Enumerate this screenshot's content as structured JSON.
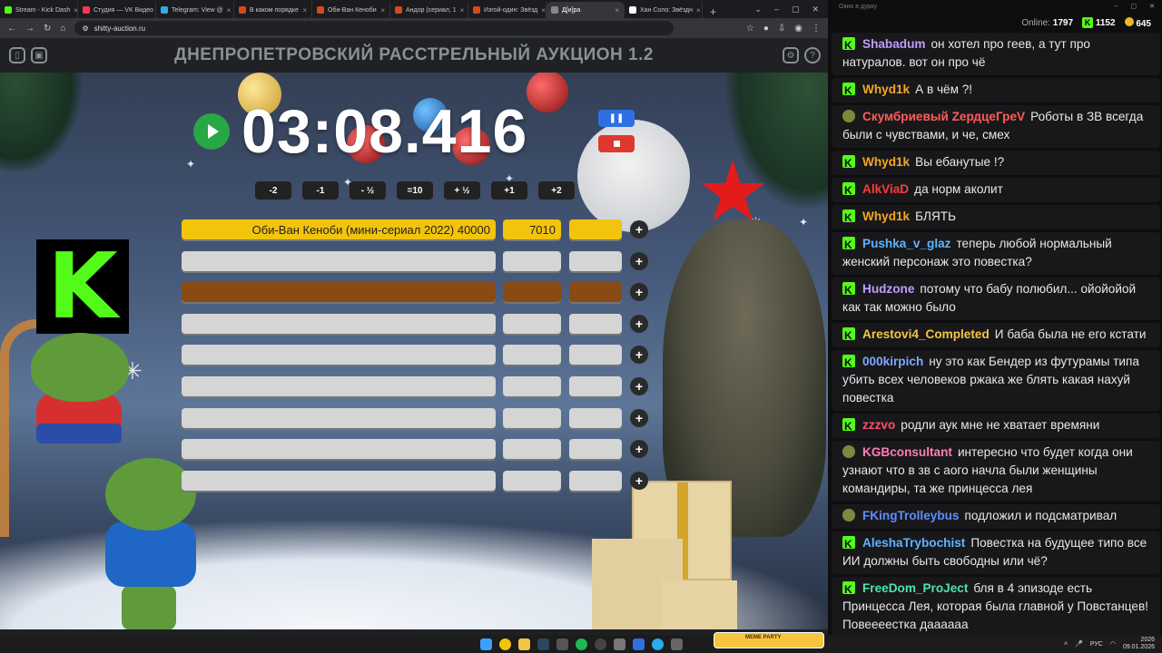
{
  "browser": {
    "tabs": [
      {
        "label": "Stream - Kick Dash",
        "color": "#53fc18",
        "active": false
      },
      {
        "label": "Студия — VK Видео",
        "color": "#ff3355",
        "active": false
      },
      {
        "label": "Telegram: View @",
        "color": "#2aabee",
        "active": false
      },
      {
        "label": "В каком порядке",
        "color": "#d44a1f",
        "active": false
      },
      {
        "label": "Оби-Ван Кеноби",
        "color": "#d44a1f",
        "active": false
      },
      {
        "label": "Андор (сериал, 1",
        "color": "#d44a1f",
        "active": false
      },
      {
        "label": "Изгой-один: Звёзд",
        "color": "#d44a1f",
        "active": false
      },
      {
        "label": "Д[и]ра",
        "color": "#888888",
        "active": true
      },
      {
        "label": "Хан Соло: Звёздн",
        "color": "#ffffff",
        "active": false
      }
    ],
    "url": "shitty-auction.ru"
  },
  "auction": {
    "title": "ДНЕПРОПЕТРОВСКИЙ РАССТРЕЛЬНЫЙ АУКЦИОН 1.2",
    "timer": "03:08.416",
    "adjust_buttons": [
      "-2",
      "-1",
      "- ½",
      "=10",
      "+ ½",
      "+1",
      "+2"
    ],
    "lots": [
      {
        "name": "Оби-Ван Кеноби (мини-сериал 2022) 40000",
        "amount": "7010",
        "style": "gold"
      },
      {
        "name": "",
        "amount": "",
        "style": "empty"
      },
      {
        "name": "",
        "amount": "",
        "style": "brown"
      },
      {
        "name": "",
        "amount": "",
        "style": "empty"
      },
      {
        "name": "",
        "amount": "",
        "style": "empty"
      },
      {
        "name": "",
        "amount": "",
        "style": "empty"
      },
      {
        "name": "",
        "amount": "",
        "style": "empty"
      },
      {
        "name": "",
        "amount": "",
        "style": "empty"
      },
      {
        "name": "",
        "amount": "",
        "style": "empty"
      }
    ]
  },
  "chat": {
    "window_title": "Окно в дурку",
    "online_label": "Online:",
    "online_count": "1797",
    "followers": "1152",
    "coins": "645",
    "messages": [
      {
        "user": "Shabadum",
        "color": "#c39bff",
        "badge": "kick",
        "text": "он хотел про геев, а тут про натуралов. вот он про чё"
      },
      {
        "user": "Whyd1k",
        "color": "#f5a623",
        "badge": "kick",
        "text": "А в чём ?!"
      },
      {
        "user": "Скумбриевый ZердцеГреV",
        "color": "#ff5c5c",
        "badge": "mod",
        "text": "Роботы в ЗВ всегда были с чувствами, и че, смех"
      },
      {
        "user": "Whyd1k",
        "color": "#f5a623",
        "badge": "kick",
        "text": "Вы ебанутые !?"
      },
      {
        "user": "AlkViaD",
        "color": "#ff3b3b",
        "badge": "kick",
        "text": "да норм аколит"
      },
      {
        "user": "Whyd1k",
        "color": "#f5a623",
        "badge": "kick",
        "text": "БЛЯТЬ"
      },
      {
        "user": "Pushka_v_glaz",
        "color": "#5fb3ff",
        "badge": "kick",
        "text": "теперь любой нормальный женский персонаж это повестка?"
      },
      {
        "user": "Hudzone",
        "color": "#c39bff",
        "badge": "kick",
        "text": "потому что бабу полюбил... ойойойой как так можно было"
      },
      {
        "user": "Arestovi4_Completed",
        "color": "#f5c542",
        "badge": "kick",
        "text": "И баба была не его кстати"
      },
      {
        "user": "000kirpich",
        "color": "#7fa8ff",
        "badge": "kick",
        "text": "ну это как Бендер из футурамы типа убить всех человеков ржака же блять какая нахуй повестка"
      },
      {
        "user": "zzzvo",
        "color": "#ff4d6d",
        "badge": "kick",
        "text": "родли аук мне не хватает времяни"
      },
      {
        "user": "KGBconsultant",
        "color": "#ff7eb6",
        "badge": "mod",
        "text": "интересно что будет когда они узнают что в зв с аого начла были женщины командиры, та же принцесса лея"
      },
      {
        "user": "FKingTrolleybus",
        "color": "#5f8dff",
        "badge": "mod",
        "text": "подложил и подсматривал"
      },
      {
        "user": "AleshaTrybochist",
        "color": "#5fb3ff",
        "badge": "kick",
        "text": "Повестка на будущее типо все ИИ должны быть свободны или чё?"
      },
      {
        "user": "FreeDom_ProJect",
        "color": "#4de3b0",
        "badge": "kick",
        "text": "бля в 4 эпизоде есть Принцесса Лея, которая была главной у Повстанцев! Повеееестка даааааа"
      }
    ]
  },
  "taskbar": {
    "lang": "РУС",
    "time": "2026",
    "date": "09.01.2026",
    "meme_label": "MEME PARTY"
  }
}
